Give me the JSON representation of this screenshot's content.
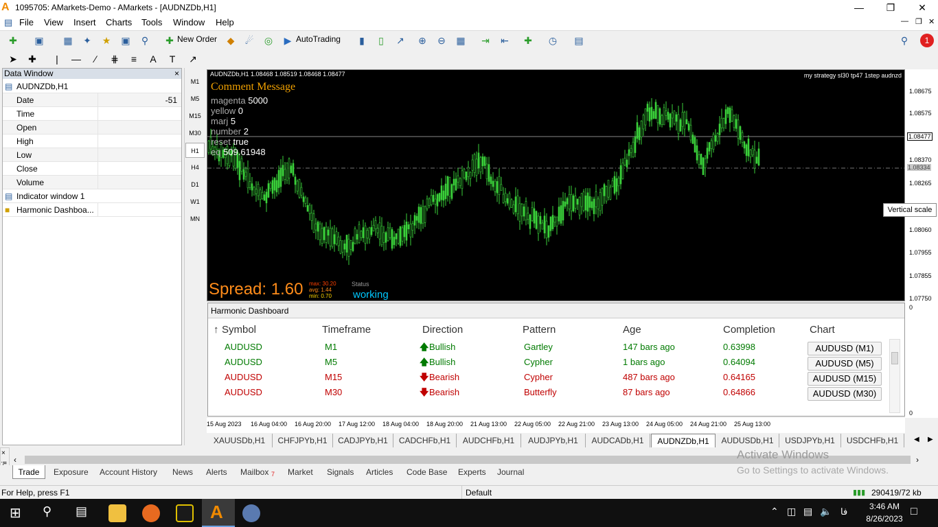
{
  "window": {
    "title": "1095705: AMarkets-Demo - AMarkets - [AUDNZDb,H1]",
    "logo": "A"
  },
  "menu": [
    "File",
    "View",
    "Insert",
    "Charts",
    "Tools",
    "Window",
    "Help"
  ],
  "toolbar": {
    "new_order": "New Order",
    "autotrading": "AutoTrading"
  },
  "data_window": {
    "title": "Data Window",
    "symbol": "AUDNZDb,H1",
    "rows": [
      {
        "label": "Date",
        "value": "-51"
      },
      {
        "label": "Time",
        "value": ""
      },
      {
        "label": "Open",
        "value": ""
      },
      {
        "label": "High",
        "value": ""
      },
      {
        "label": "Low",
        "value": ""
      },
      {
        "label": "Close",
        "value": ""
      },
      {
        "label": "Volume",
        "value": ""
      }
    ],
    "indicator": "Indicator window 1",
    "dashboard": "Harmonic Dashboa..."
  },
  "timeframes": [
    "M1",
    "M5",
    "M15",
    "M30",
    "H1",
    "H4",
    "D1",
    "W1",
    "MN"
  ],
  "chart": {
    "header": "AUDNZDb,H1  1.08468 1.08519 1.08468 1.08477",
    "strategy": "my strategy sl30 tp47 1step audnzd",
    "comment_title": "Comment Message",
    "comment_lines": [
      {
        "k": "magenta",
        "v": "5000"
      },
      {
        "k": "yellow",
        "v": "0"
      },
      {
        "k": "marj",
        "v": "5"
      },
      {
        "k": "number",
        "v": "2"
      },
      {
        "k": "reset",
        "v": "true"
      },
      {
        "k": "eq",
        "v": "509.61948"
      }
    ],
    "spread": "Spread: 1.60",
    "spread_max": "max: 30.20",
    "spread_avg": "avg:  1.44",
    "spread_min": "min:  0.70",
    "status_label": "Status",
    "status_value": "working",
    "tooltip": "Vertical scale",
    "prices": [
      "1.08675",
      "1.08575",
      "1.08477",
      "1.08370",
      "1.08334",
      "1.08265",
      "1.08060",
      "1.07955",
      "1.07855",
      "1.07750"
    ],
    "dashboard_scale": [
      "0",
      "0"
    ]
  },
  "harmonic_dashboard": {
    "title": "Harmonic Dashboard",
    "columns": [
      "Symbol",
      "Timeframe",
      "Direction",
      "Pattern",
      "Age",
      "Completion",
      "Chart"
    ],
    "rows": [
      {
        "symbol": "AUDUSD",
        "tf": "M1",
        "dir": "Bullish",
        "pattern": "Gartley",
        "age": "147 bars ago",
        "completion": "0.63998",
        "chart": "AUDUSD (M1)"
      },
      {
        "symbol": "AUDUSD",
        "tf": "M5",
        "dir": "Bullish",
        "pattern": "Cypher",
        "age": "1 bars ago",
        "completion": "0.64094",
        "chart": "AUDUSD (M5)"
      },
      {
        "symbol": "AUDUSD",
        "tf": "M15",
        "dir": "Bearish",
        "pattern": "Cypher",
        "age": "487 bars ago",
        "completion": "0.64165",
        "chart": "AUDUSD (M15)"
      },
      {
        "symbol": "AUDUSD",
        "tf": "M30",
        "dir": "Bearish",
        "pattern": "Butterfly",
        "age": "87 bars ago",
        "completion": "0.64866",
        "chart": "AUDUSD (M30)"
      }
    ]
  },
  "time_axis": [
    "15 Aug 2023",
    "16 Aug 04:00",
    "16 Aug 20:00",
    "17 Aug 12:00",
    "18 Aug 04:00",
    "18 Aug 20:00",
    "21 Aug 13:00",
    "22 Aug 05:00",
    "22 Aug 21:00",
    "23 Aug 13:00",
    "24 Aug 05:00",
    "24 Aug 21:00",
    "25 Aug 13:00"
  ],
  "chart_tabs": [
    "XAUUSDb,H1",
    "CHFJPYb,H1",
    "CADJPYb,H1",
    "CADCHFb,H1",
    "AUDCHFb,H1",
    "AUDJPYb,H1",
    "AUDCADb,H1",
    "AUDNZDb,H1",
    "AUDUSDb,H1",
    "USDJPYb,H1",
    "USDCHFb,H1"
  ],
  "terminal_tabs": [
    "Trade",
    "Exposure",
    "Account History",
    "News",
    "Alerts",
    "Mailbox",
    "Market",
    "Signals",
    "Articles",
    "Code Base",
    "Experts",
    "Journal"
  ],
  "terminal": {
    "label": "Termi",
    "mailbox_count": "7"
  },
  "watermark": {
    "line1": "Activate Windows",
    "line2": "Go to Settings to activate Windows."
  },
  "statusbar": {
    "help": "For Help, press F1",
    "profile": "Default",
    "traffic": "290419/72 kb"
  },
  "taskbar": {
    "time": "3:46 AM",
    "date": "8/26/2023",
    "lang": "فا"
  },
  "colors": {
    "bull": "#007a00",
    "bear": "#c00000",
    "candle": "#3ad13a",
    "spread": "#ff8c1a",
    "status": "#00c8ff",
    "title_orange": "#f08a00"
  },
  "notification_count": "1"
}
